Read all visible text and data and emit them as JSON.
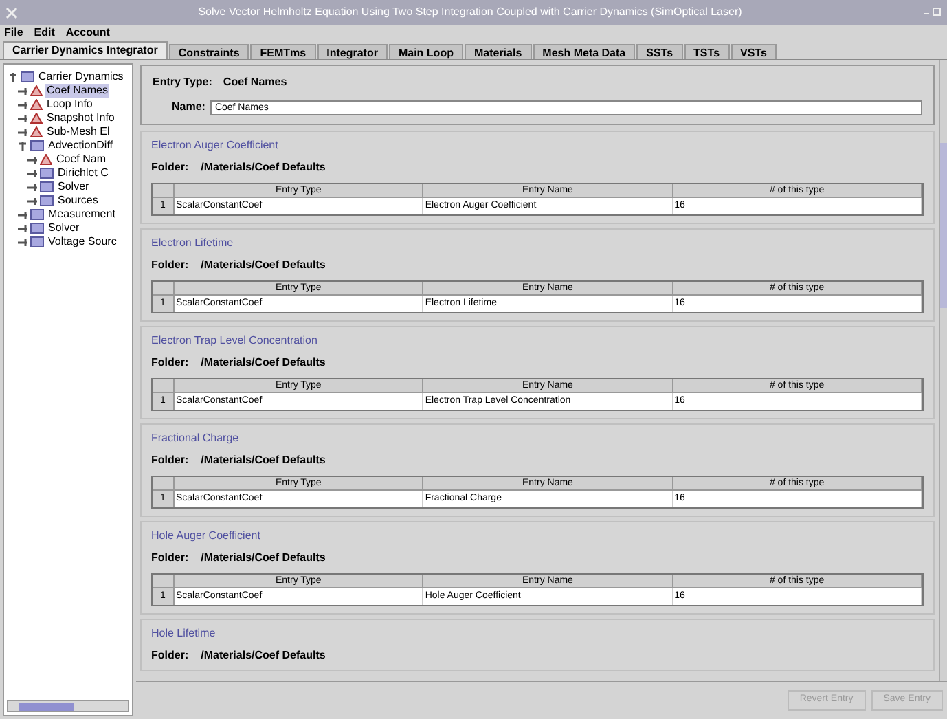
{
  "window": {
    "title": "Solve Vector Helmholtz Equation Using Two Step Integration Coupled with Carrier Dynamics (SimOptical Laser)"
  },
  "menu": [
    "File",
    "Edit",
    "Account"
  ],
  "tabs": [
    {
      "label": "Carrier Dynamics Integrator",
      "selected": true
    },
    {
      "label": "Constraints",
      "selected": false
    },
    {
      "label": "FEMTms",
      "selected": false
    },
    {
      "label": "Integrator",
      "selected": false
    },
    {
      "label": "Main Loop",
      "selected": false
    },
    {
      "label": "Materials",
      "selected": false
    },
    {
      "label": "Mesh Meta Data",
      "selected": false
    },
    {
      "label": "SSTs",
      "selected": false
    },
    {
      "label": "TSTs",
      "selected": false
    },
    {
      "label": "VSTs",
      "selected": false
    }
  ],
  "tree": [
    {
      "label": "Carrier Dynamics",
      "kind": "folder",
      "expanded": true,
      "selected": false,
      "children": [
        {
          "label": "Coef Names",
          "kind": "warning",
          "expanded": false,
          "selected": true
        },
        {
          "label": "Loop Info",
          "kind": "warning",
          "expanded": false,
          "selected": false
        },
        {
          "label": "Snapshot Info",
          "kind": "warning",
          "expanded": false,
          "selected": false
        },
        {
          "label": "Sub-Mesh El",
          "kind": "warning",
          "expanded": false,
          "selected": false
        },
        {
          "label": "AdvectionDiff",
          "kind": "folder",
          "expanded": true,
          "selected": false,
          "children": [
            {
              "label": "Coef Nam",
              "kind": "warning",
              "expanded": false,
              "selected": false
            },
            {
              "label": "Dirichlet C",
              "kind": "folder",
              "expanded": false,
              "selected": false
            },
            {
              "label": "Solver",
              "kind": "folder",
              "expanded": false,
              "selected": false
            },
            {
              "label": "Sources",
              "kind": "folder",
              "expanded": false,
              "selected": false
            }
          ]
        },
        {
          "label": "Measurement",
          "kind": "folder",
          "expanded": false,
          "selected": false
        },
        {
          "label": "Solver",
          "kind": "folder",
          "expanded": false,
          "selected": false
        },
        {
          "label": "Voltage Sourc",
          "kind": "folder",
          "expanded": false,
          "selected": false
        }
      ]
    }
  ],
  "entry": {
    "type_label": "Entry Type:",
    "type_value": "Coef Names",
    "name_label": "Name:",
    "name_value": "Coef Names"
  },
  "sections": [
    {
      "title": "Electron Auger Coefficient",
      "folder_label": "Folder:",
      "folder": "/Materials/Coef Defaults",
      "columns": [
        "",
        "Entry Type",
        "Entry Name",
        "# of this type"
      ],
      "rows": [
        [
          "1",
          "ScalarConstantCoef",
          "Electron Auger Coefficient",
          "16"
        ]
      ]
    },
    {
      "title": "Electron Lifetime",
      "folder_label": "Folder:",
      "folder": "/Materials/Coef Defaults",
      "columns": [
        "",
        "Entry Type",
        "Entry Name",
        "# of this type"
      ],
      "rows": [
        [
          "1",
          "ScalarConstantCoef",
          "Electron Lifetime",
          "16"
        ]
      ]
    },
    {
      "title": "Electron Trap Level Concentration",
      "folder_label": "Folder:",
      "folder": "/Materials/Coef Defaults",
      "columns": [
        "",
        "Entry Type",
        "Entry Name",
        "# of this type"
      ],
      "rows": [
        [
          "1",
          "ScalarConstantCoef",
          "Electron Trap Level Concentration",
          "16"
        ]
      ]
    },
    {
      "title": "Fractional Charge",
      "folder_label": "Folder:",
      "folder": "/Materials/Coef Defaults",
      "columns": [
        "",
        "Entry Type",
        "Entry Name",
        "# of this type"
      ],
      "rows": [
        [
          "1",
          "ScalarConstantCoef",
          "Fractional Charge",
          "16"
        ]
      ]
    },
    {
      "title": "Hole Auger Coefficient",
      "folder_label": "Folder:",
      "folder": "/Materials/Coef Defaults",
      "columns": [
        "",
        "Entry Type",
        "Entry Name",
        "# of this type"
      ],
      "rows": [
        [
          "1",
          "ScalarConstantCoef",
          "Hole Auger Coefficient",
          "16"
        ]
      ]
    },
    {
      "title": "Hole Lifetime",
      "folder_label": "Folder:",
      "folder": "/Materials/Coef Defaults"
    }
  ],
  "buttons": [
    {
      "label": "Revert Entry",
      "disabled": true
    },
    {
      "label": "Save Entry",
      "disabled": true
    }
  ]
}
